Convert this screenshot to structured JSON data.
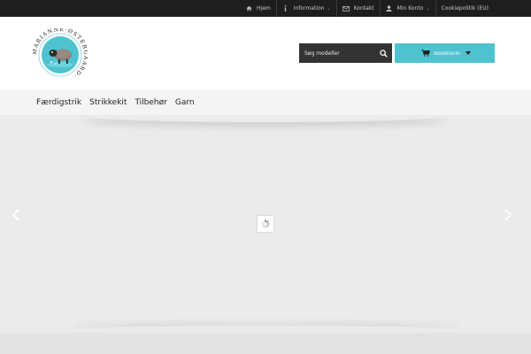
{
  "topbar": {
    "links": [
      {
        "label": "Hjem",
        "icon": "home-icon"
      },
      {
        "label": "Information",
        "icon": "info-icon"
      },
      {
        "label": "Kontakt",
        "icon": "mail-icon"
      },
      {
        "label": "Min Konto",
        "icon": "user-icon"
      },
      {
        "label": "Cookiepolitik (EU)"
      }
    ]
  },
  "logo": {
    "text": "MARIANNE·ØSTERGAARD·",
    "ring_color": "#4ec3cf"
  },
  "search": {
    "placeholder": "Søg modeller"
  },
  "cart": {
    "label": "Indkøbskurv",
    "color": "#4ec3cf"
  },
  "nav": {
    "items": [
      "Færdigstrik",
      "Strikkekit",
      "Tilbehør",
      "Garn"
    ]
  }
}
